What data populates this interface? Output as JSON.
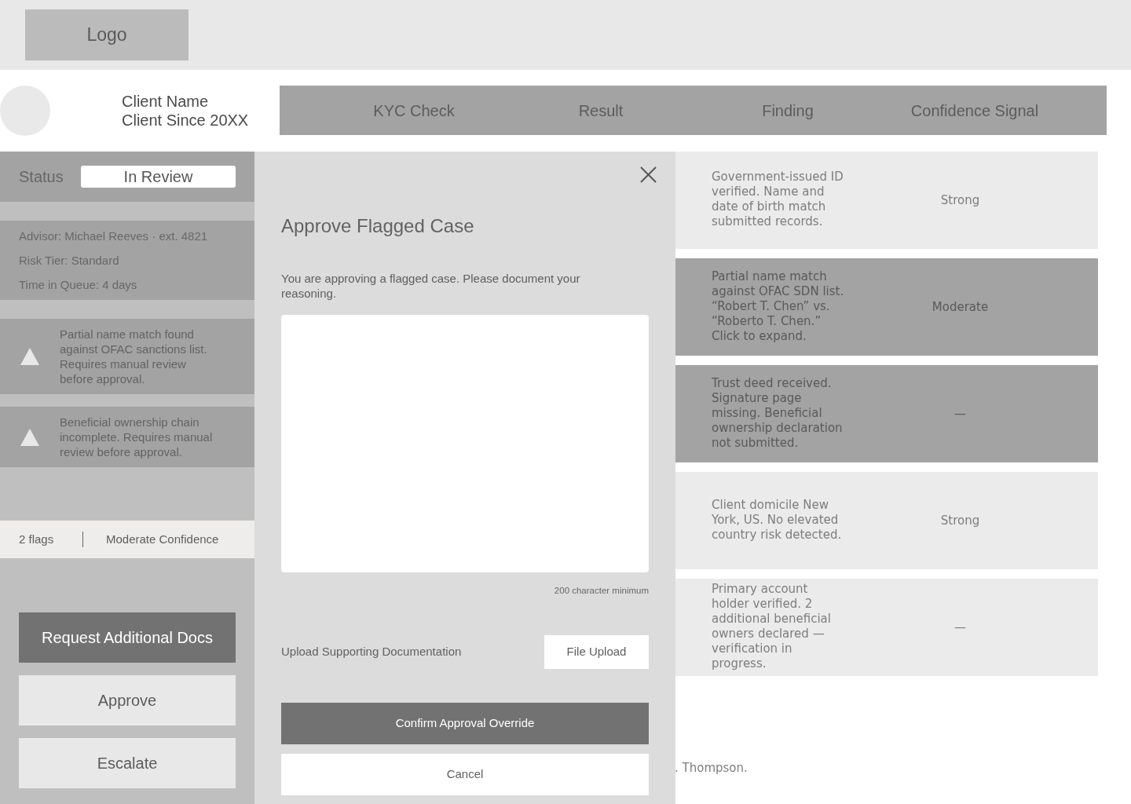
{
  "header": {
    "logo": "Logo"
  },
  "client": {
    "name": "Client Name",
    "since": "Client Since 20XX"
  },
  "sidebar": {
    "status": {
      "label": "Status",
      "value": "In Review"
    },
    "details": [
      "Advisor: Michael Reeves · ext. 4821",
      "Risk Tier: Standard",
      "Time in Queue: 4 days"
    ],
    "flags": [
      {
        "text": "Partial name match found against OFAC sanctions list. Requires manual review before approval."
      },
      {
        "text": "Beneficial ownership chain incomplete. Requires manual review before approval."
      }
    ],
    "summary": {
      "flags": "2 flags",
      "confidence": "Moderate Confidence"
    },
    "actions": [
      {
        "label": "Request Additional Docs",
        "kind": "primary"
      },
      {
        "label": "Approve",
        "kind": "secondary"
      },
      {
        "label": "Escalate",
        "kind": "secondary"
      }
    ]
  },
  "table": {
    "columns": [
      "KYC Check",
      "Result",
      "Finding",
      "Confidence Signal"
    ],
    "rows": [
      {
        "finding": "Government-issued ID verified. Name and date of birth match submitted records.",
        "confidence": "Strong",
        "flagged": false
      },
      {
        "finding": "Partial name match against OFAC SDN list. “Robert T. Chen” vs. “Roberto T. Chen.” Click to expand.",
        "confidence": "Moderate",
        "flagged": true
      },
      {
        "finding": "Trust deed received. Signature page missing. Beneficial ownership declaration not submitted.",
        "confidence": "—",
        "flagged": true
      },
      {
        "finding": "Client domicile New York, US. No elevated country risk detected.",
        "confidence": "Strong",
        "flagged": false
      },
      {
        "finding": "Primary account holder verified. 2 additional beneficial owners declared — verification in progress.",
        "confidence": "—",
        "flagged": false
      }
    ],
    "footnote": ". Thompson."
  },
  "modal": {
    "title": "Approve Flagged Case",
    "message": "You are approving a flagged case. Please document your reasoning.",
    "reasoning_hint": "200 character minimum",
    "upload": {
      "label": "Upload Supporting Documentation",
      "button": "File Upload"
    },
    "buttons": [
      {
        "label": "Confirm Approval Override",
        "kind": "primary"
      },
      {
        "label": "Cancel",
        "kind": "secondary"
      }
    ]
  }
}
